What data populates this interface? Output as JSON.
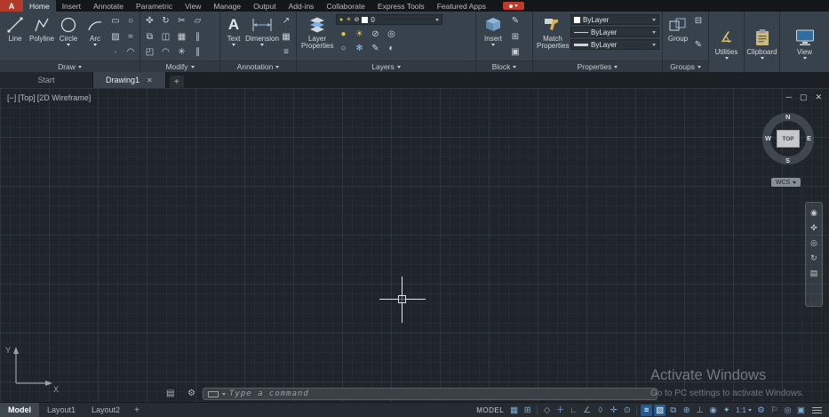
{
  "titlebar": {
    "logo": "A",
    "menus": [
      "Home",
      "Insert",
      "Annotate",
      "Parametric",
      "View",
      "Manage",
      "Output",
      "Add-ins",
      "Collaborate",
      "Express Tools",
      "Featured Apps"
    ]
  },
  "ribbon": {
    "draw": {
      "title": "Draw",
      "line": "Line",
      "polyline": "Polyline",
      "circle": "Circle",
      "arc": "Arc"
    },
    "modify": {
      "title": "Modify"
    },
    "annotation": {
      "title": "Annotation",
      "text": "Text",
      "dimension": "Dimension"
    },
    "layers": {
      "title": "Layers",
      "layer_properties": "Layer Properties",
      "current_layer": "0"
    },
    "block": {
      "title": "Block",
      "insert": "Insert"
    },
    "properties": {
      "title": "Properties",
      "match_properties": "Match Properties",
      "color": "ByLayer",
      "linetype": "ByLayer",
      "lineweight": "ByLayer"
    },
    "groups": {
      "title": "Groups",
      "group": "Group"
    },
    "utilities": {
      "title": "Utilities"
    },
    "clipboard": {
      "title": "Clipboard"
    },
    "view": {
      "title": "View"
    }
  },
  "file_tabs": {
    "start": "Start",
    "drawing1": "Drawing1"
  },
  "viewport": {
    "controls": {
      "collapse": "[−]",
      "view_name": "[Top]",
      "visual_style": "[2D Wireframe]"
    },
    "viewcube": {
      "n": "N",
      "w": "W",
      "e": "E",
      "s": "S",
      "top": "TOP",
      "wcs": "WCS"
    }
  },
  "ucs": {
    "x": "X",
    "y": "Y"
  },
  "command_line": {
    "placeholder": "Type a command"
  },
  "watermark": {
    "line1": "Activate Windows",
    "line2": "Go to PC settings to activate Windows."
  },
  "statusbar": {
    "model_tab": "Model",
    "layout1_tab": "Layout1",
    "layout2_tab": "Layout2",
    "mode": "MODEL",
    "scale": "1:1",
    "icons": [
      {
        "name": "grid",
        "glyph": "▦",
        "on": false
      },
      {
        "name": "snap-mode",
        "glyph": "⊞",
        "on": false
      },
      {
        "name": "infer-constraints",
        "glyph": "◇",
        "on": false
      },
      {
        "name": "dynamic-input",
        "glyph": "＋",
        "on": false
      },
      {
        "name": "ortho-mode",
        "glyph": "∟",
        "on": false
      },
      {
        "name": "polar-tracking",
        "glyph": "∠",
        "on": false
      },
      {
        "name": "isometric-drafting",
        "glyph": "◊",
        "on": false
      },
      {
        "name": "osnap-tracking",
        "glyph": "✛",
        "on": false
      },
      {
        "name": "object-snap",
        "glyph": "⊙",
        "on": false
      },
      {
        "name": "lineweight",
        "glyph": "≡",
        "on": true
      },
      {
        "name": "transparency",
        "glyph": "▨",
        "on": true
      },
      {
        "name": "selection-cycling",
        "glyph": "⧉",
        "on": false
      },
      {
        "name": "3d-object-snap",
        "glyph": "⊕",
        "on": false
      },
      {
        "name": "dynamic-ucs",
        "glyph": "⊥",
        "on": false
      },
      {
        "name": "annotation-visibility",
        "glyph": "◉",
        "on": false
      },
      {
        "name": "autoscale",
        "glyph": "✦",
        "on": false
      },
      {
        "name": "workspace",
        "glyph": "⚙",
        "on": false
      },
      {
        "name": "annotation-monitor",
        "glyph": "⚐",
        "on": false
      },
      {
        "name": "isolate-objects",
        "glyph": "◎",
        "on": false
      },
      {
        "name": "graphics-performance",
        "glyph": "▣",
        "on": false
      }
    ]
  },
  "icons": {
    "rect": "▭",
    "ellipse": "○",
    "hatch": "▨",
    "spline": "≈",
    "point": "∙",
    "arc2": "◠",
    "move": "✜",
    "rotate": "↻",
    "trim": "✂",
    "erase": "▱",
    "copy": "⧉",
    "mirror": "◫",
    "array": "▦",
    "offset": "∥",
    "scale": "◰",
    "fillet": "◠",
    "explode": "✳",
    "leader": "↗",
    "table": "▦",
    "textstyle": "≡",
    "bulb": "●",
    "sun": "☀",
    "lock": "⊘",
    "isolate": "◎",
    "bulb_off": "○",
    "freeze": "❄",
    "matchlayer": "✎",
    "halfbulb": "◐",
    "edit": "✎",
    "createblock": "⊞",
    "attrs": "▣",
    "ungroup": "⊟",
    "measure": "∡",
    "textA": "A",
    "min": "─",
    "restore": "▢",
    "close": "✕",
    "wheel": "◉",
    "pan": "✜",
    "zoom": "◎",
    "orbit": "↻",
    "motion": "▤",
    "dock_grid": "▤",
    "wrench": "⚙",
    "plus": "+"
  },
  "colors": {
    "accent_red": "#b33a2b",
    "ribbon_bg": "#38424c",
    "icon_blue": "#7cabd8",
    "canvas_bg": "#1f252b"
  }
}
